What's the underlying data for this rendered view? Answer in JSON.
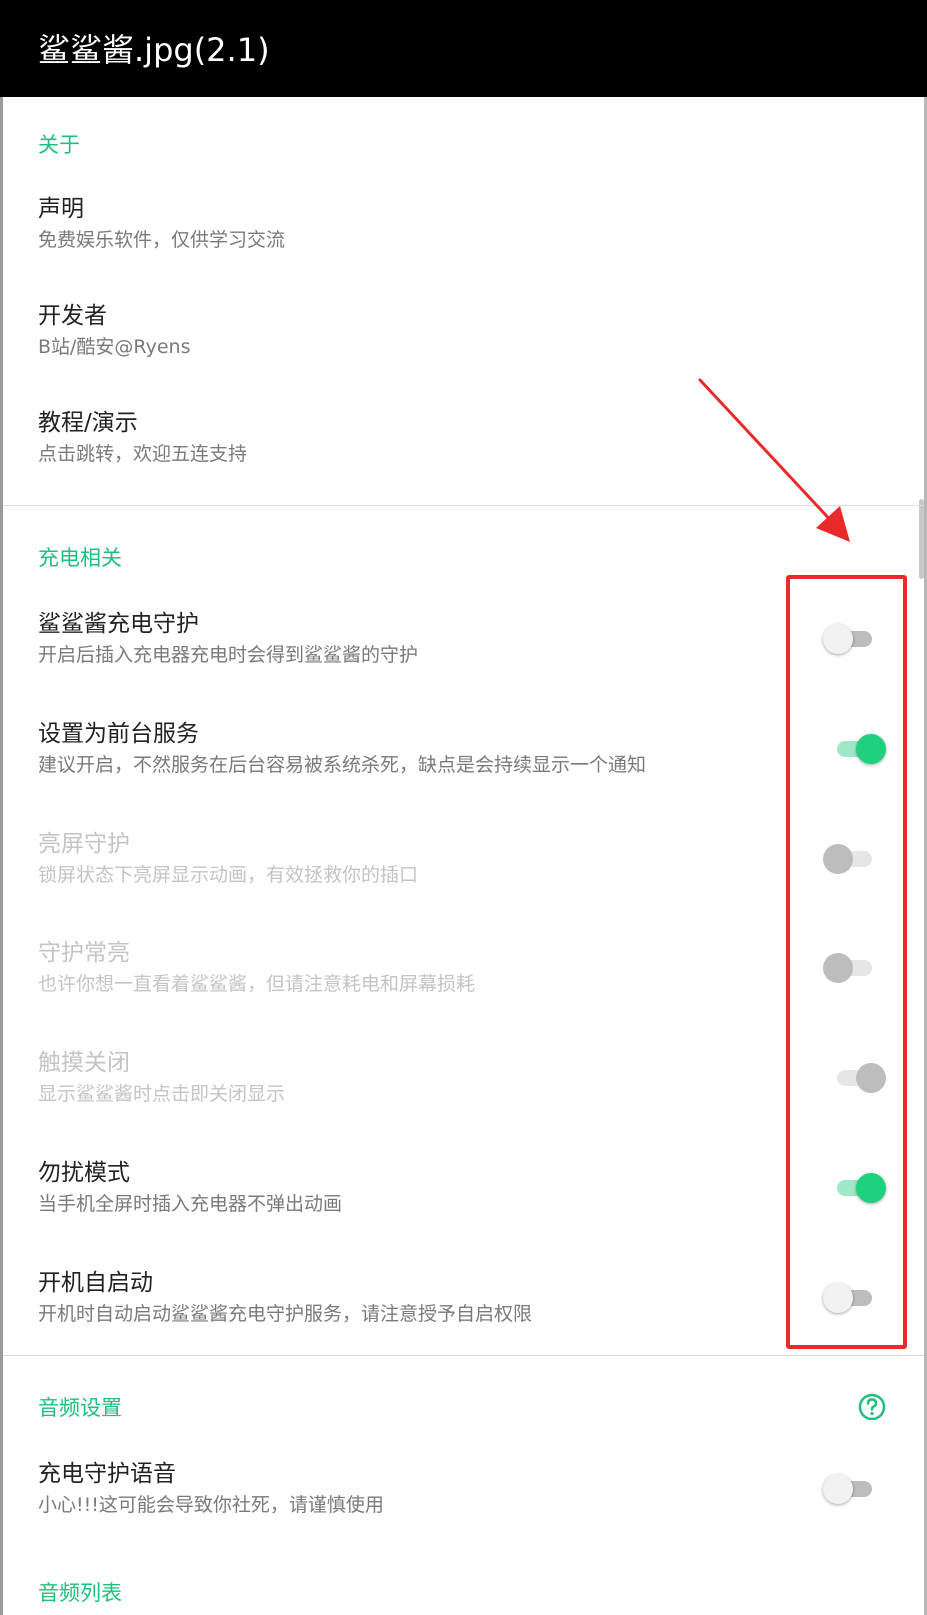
{
  "app_bar": {
    "title": "鲨鲨酱.jpg(2.1)"
  },
  "sections": {
    "about": {
      "title": "关于",
      "items": [
        {
          "title": "声明",
          "summary": "免费娱乐软件，仅供学习交流"
        },
        {
          "title": "开发者",
          "summary": "B站/酷安@Ryens"
        },
        {
          "title": "教程/演示",
          "summary": "点击跳转，欢迎五连支持"
        }
      ]
    },
    "charging": {
      "title": "充电相关",
      "items": [
        {
          "title": "鲨鲨酱充电守护",
          "summary": "开启后插入充电器充电时会得到鲨鲨酱的守护",
          "checked": false,
          "enabled": true
        },
        {
          "title": "设置为前台服务",
          "summary": "建议开启，不然服务在后台容易被系统杀死，缺点是会持续显示一个通知",
          "checked": true,
          "enabled": true
        },
        {
          "title": "亮屏守护",
          "summary": "锁屏状态下亮屏显示动画，有效拯救你的插口",
          "checked": false,
          "enabled": false
        },
        {
          "title": "守护常亮",
          "summary": "也许你想一直看着鲨鲨酱，但请注意耗电和屏幕损耗",
          "checked": false,
          "enabled": false
        },
        {
          "title": "触摸关闭",
          "summary": "显示鲨鲨酱时点击即关闭显示",
          "checked": true,
          "enabled": false
        },
        {
          "title": "勿扰模式",
          "summary": "当手机全屏时插入充电器不弹出动画",
          "checked": true,
          "enabled": true
        },
        {
          "title": "开机自启动",
          "summary": "开机时自动启动鲨鲨酱充电守护服务，请注意授予自启权限",
          "checked": false,
          "enabled": true
        }
      ]
    },
    "audio_settings": {
      "title": "音频设置",
      "help_icon": "question-circle-icon",
      "items": [
        {
          "title": "充电守护语音",
          "summary": "小心!!!这可能会导致你社死，请谨慎使用",
          "checked": false,
          "enabled": true
        }
      ]
    },
    "audio_list": {
      "title": "音频列表"
    }
  },
  "colors": {
    "accent": "#1fbf7d",
    "switch_on": "#1fd07e",
    "annotation": "#ea2a2a",
    "app_bar": "#000000"
  },
  "annotation": {
    "type": "red-box-with-arrow",
    "highlights": "toggle switches"
  }
}
